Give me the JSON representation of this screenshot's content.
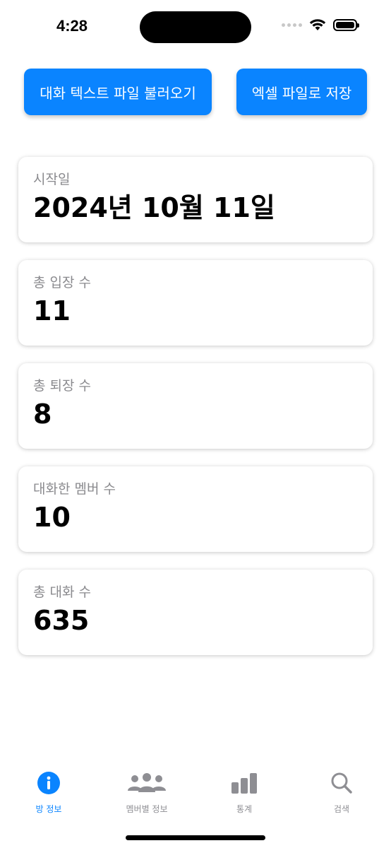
{
  "status_bar": {
    "time": "4:28"
  },
  "actions": {
    "load_label": "대화 텍스트 파일 불러오기",
    "export_label": "엑셀 파일로 저장"
  },
  "cards": [
    {
      "label": "시작일",
      "value": "2024년 10월 11일"
    },
    {
      "label": "총 입장 수",
      "value": "11"
    },
    {
      "label": "총 퇴장 수",
      "value": "8"
    },
    {
      "label": "대화한 멤버 수",
      "value": "10"
    },
    {
      "label": "총 대화 수",
      "value": "635"
    }
  ],
  "tab_bar": {
    "tabs": [
      {
        "label": "방 정보",
        "icon": "info-icon",
        "active": true
      },
      {
        "label": "멤버별 정보",
        "icon": "people-icon",
        "active": false
      },
      {
        "label": "통계",
        "icon": "bar-chart-icon",
        "active": false
      },
      {
        "label": "검색",
        "icon": "search-icon",
        "active": false
      }
    ]
  },
  "colors": {
    "accent": "#0a84ff",
    "inactive": "#8e8e93",
    "label_gray": "#8a8a8e"
  }
}
